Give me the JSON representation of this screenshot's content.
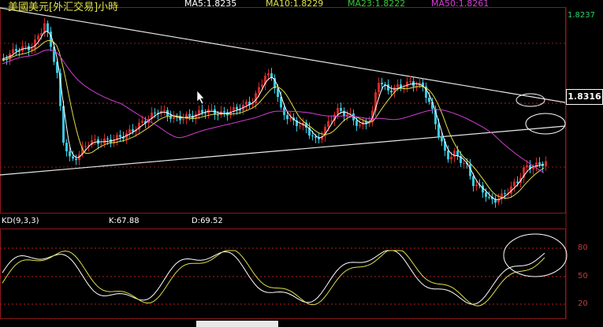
{
  "header": {
    "title": "美國美元[外汇交易]小時",
    "ma5": "MA5:1.8235",
    "ma10": "MA10:1.8229",
    "ma23": "MA23:1.8222",
    "ma50": "MA50:1.8261"
  },
  "top_right_price": "1.8237",
  "current_price": "1.8316",
  "kd": {
    "label": "KD(9,3,3)",
    "k": "K:67.88",
    "d": "D:69.52",
    "ticks": [
      "80",
      "50",
      "20"
    ]
  },
  "colors": {
    "up_candle": "#d02828",
    "down_candle": "#39c7e0",
    "ma5": "#ffffff",
    "ma10": "#e0e04a",
    "ma23": "#34c734",
    "ma50": "#d43dd4",
    "k_line": "#ffffff",
    "d_line": "#e0e04a",
    "grid": "#8b1a1a"
  },
  "chart_data": {
    "type": "candlestick",
    "title": "美國美元[外汇交易]小時",
    "series": [
      {
        "name": "MA5:1.8235",
        "values": []
      },
      {
        "name": "MA10:1.8229",
        "values": []
      },
      {
        "name": "MA23:1.8222",
        "values": []
      },
      {
        "name": "MA50:1.8261",
        "values": []
      }
    ],
    "last_price": 1.8316,
    "indicator": {
      "name": "KD(9,3,3)",
      "K": 67.88,
      "D": 69.52,
      "yticks": [
        80,
        50,
        20
      ]
    }
  }
}
